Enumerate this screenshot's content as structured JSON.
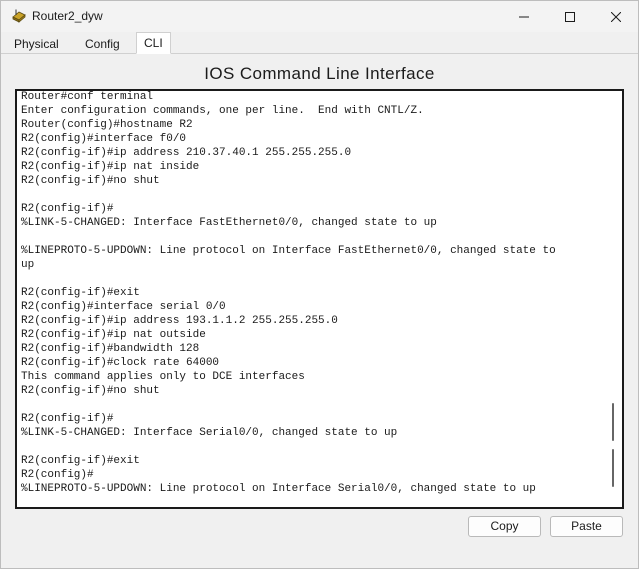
{
  "window": {
    "title": "Router2_dyw",
    "icon": "router-icon"
  },
  "tabs": [
    {
      "label": "Physical",
      "active": false
    },
    {
      "label": "Config",
      "active": false
    },
    {
      "label": "CLI",
      "active": true
    }
  ],
  "cli": {
    "heading": "IOS Command Line Interface",
    "lines": [
      "Router#conf terminal",
      "Enter configuration commands, one per line.  End with CNTL/Z.",
      "Router(config)#hostname R2",
      "R2(config)#interface f0/0",
      "R2(config-if)#ip address 210.37.40.1 255.255.255.0",
      "R2(config-if)#ip nat inside",
      "R2(config-if)#no shut",
      "",
      "R2(config-if)#",
      "%LINK-5-CHANGED: Interface FastEthernet0/0, changed state to up",
      "",
      "%LINEPROTO-5-UPDOWN: Line protocol on Interface FastEthernet0/0, changed state to",
      "up",
      "",
      "R2(config-if)#exit",
      "R2(config)#interface serial 0/0",
      "R2(config-if)#ip address 193.1.1.2 255.255.255.0",
      "R2(config-if)#ip nat outside",
      "R2(config-if)#bandwidth 128",
      "R2(config-if)#clock rate 64000",
      "This command applies only to DCE interfaces",
      "R2(config-if)#no shut",
      "",
      "R2(config-if)#",
      "%LINK-5-CHANGED: Interface Serial0/0, changed state to up",
      "",
      "R2(config-if)#exit",
      "R2(config)#",
      "%LINEPROTO-5-UPDOWN: Line protocol on Interface Serial0/0, changed state to up"
    ]
  },
  "buttons": {
    "copy": "Copy",
    "paste": "Paste"
  }
}
